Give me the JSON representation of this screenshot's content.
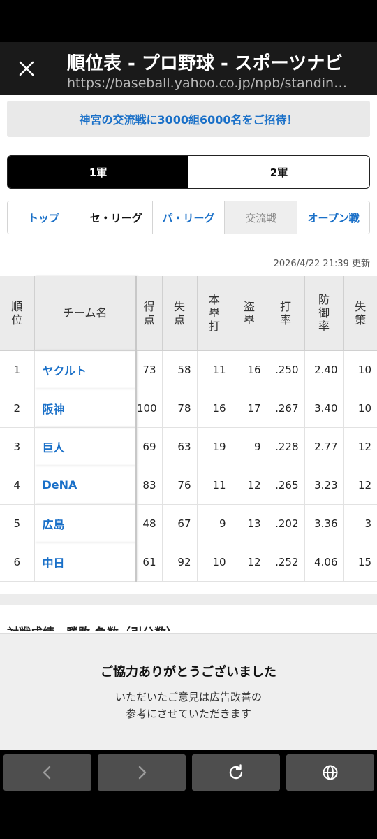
{
  "browser": {
    "title": "順位表 - プロ野球 - スポーツナビ",
    "url": "https://baseball.yahoo.co.jp/npb/standing..."
  },
  "banner": {
    "text": "神宮の交流戦に3000組6000名をご招待！"
  },
  "squad_tabs": [
    {
      "label": "1軍",
      "active": true
    },
    {
      "label": "2軍",
      "active": false
    }
  ],
  "league_tabs": [
    {
      "label": "トップ"
    },
    {
      "label": "セ・リーグ"
    },
    {
      "label": "パ・リーグ"
    },
    {
      "label": "交流戦"
    },
    {
      "label": "オープン戦"
    }
  ],
  "updated": "2026/4/22 21:39 更新",
  "table": {
    "headers": [
      "順位",
      "チーム名",
      "得点",
      "失点",
      "本塁打",
      "盗塁",
      "打率",
      "防御率",
      "失策"
    ],
    "rows": [
      [
        "1",
        "ヤクルト",
        "73",
        "58",
        "11",
        "16",
        ".250",
        "2.40",
        "10"
      ],
      [
        "2",
        "阪神",
        "100",
        "78",
        "16",
        "17",
        ".267",
        "3.40",
        "10"
      ],
      [
        "3",
        "巨人",
        "69",
        "63",
        "19",
        "9",
        ".228",
        "2.77",
        "12"
      ],
      [
        "4",
        "DeNA",
        "83",
        "76",
        "11",
        "12",
        ".265",
        "3.23",
        "12"
      ],
      [
        "5",
        "広島",
        "48",
        "67",
        "9",
        "13",
        ".202",
        "3.36",
        "3"
      ],
      [
        "6",
        "中日",
        "61",
        "92",
        "10",
        "12",
        ".252",
        "4.06",
        "15"
      ]
    ]
  },
  "partial_heading": "対戦成績・勝敗-負数（引分数）",
  "feedback": {
    "title": "ご協力ありがとうございました",
    "line1": "いただいたご意見は広告改善の",
    "line2": "参考にさせていただきます"
  },
  "nav": {
    "back": "back-icon",
    "forward": "forward-icon",
    "reload": "reload-icon",
    "globe": "globe-icon"
  },
  "colors": {
    "link": "#1a70c8",
    "header_bg": "#1a1a1a",
    "nav_button": "#4e4e4e"
  }
}
